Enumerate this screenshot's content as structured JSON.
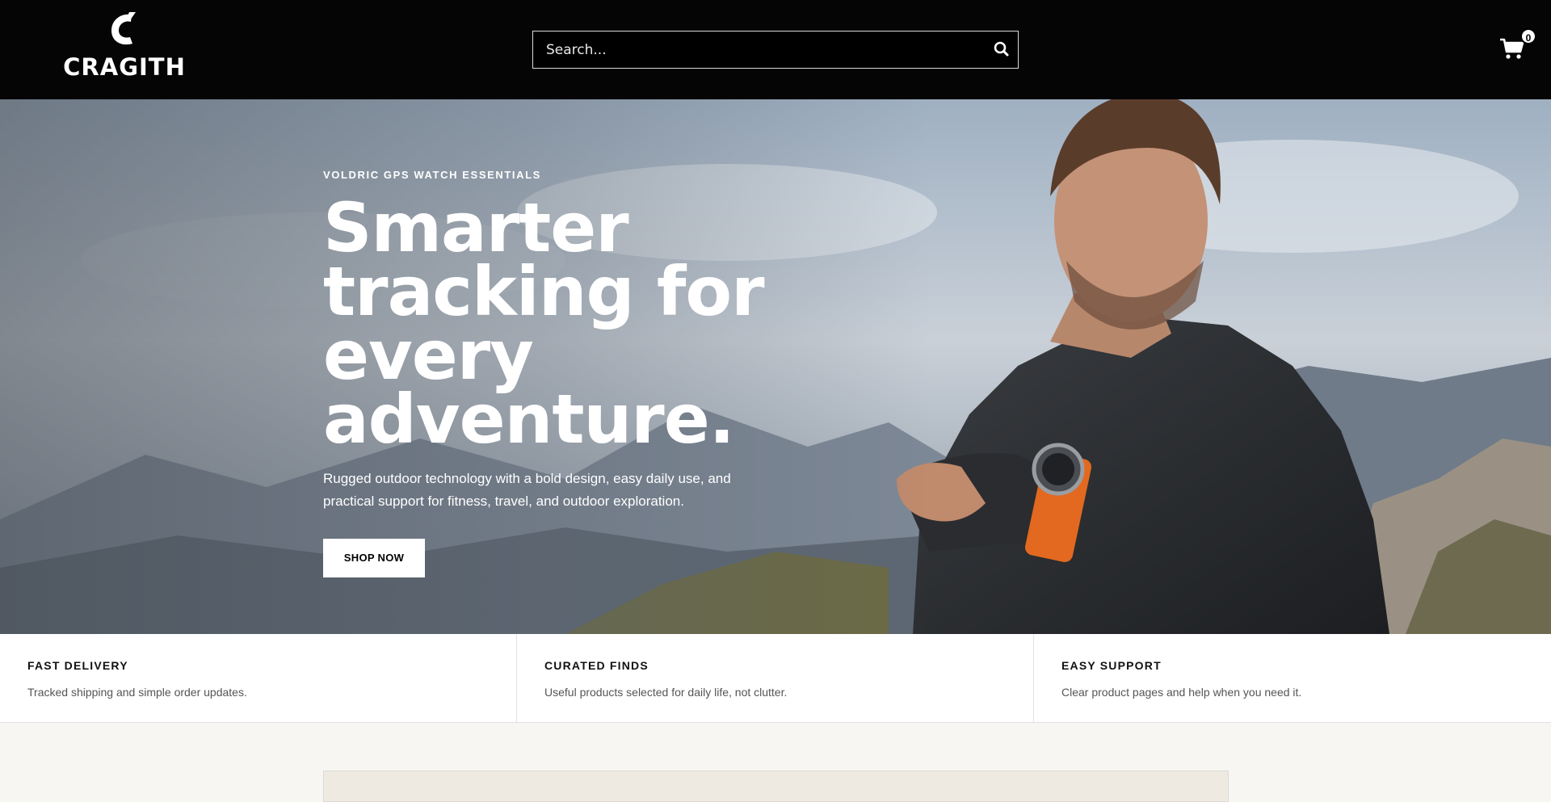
{
  "header": {
    "logo_text": "CRAGITH",
    "search_placeholder": "Search...",
    "cart_count": "0"
  },
  "hero": {
    "eyebrow": "VOLDRIC GPS WATCH ESSENTIALS",
    "headline": "Smarter tracking for every adventure.",
    "subtext": "Rugged outdoor technology with a bold design, easy daily use, and practical support for fitness, travel, and outdoor exploration.",
    "cta_label": "SHOP NOW"
  },
  "features": [
    {
      "title": "FAST DELIVERY",
      "description": "Tracked shipping and simple order updates."
    },
    {
      "title": "CURATED FINDS",
      "description": "Useful products selected for daily life, not clutter."
    },
    {
      "title": "EASY SUPPORT",
      "description": "Clear product pages and help when you need it."
    }
  ],
  "icons": {
    "search": "search-icon",
    "cart": "cart-icon"
  },
  "colors": {
    "header_bg": "#050505",
    "cta_bg": "#ffffff",
    "accent_strap": "#e2691f"
  }
}
